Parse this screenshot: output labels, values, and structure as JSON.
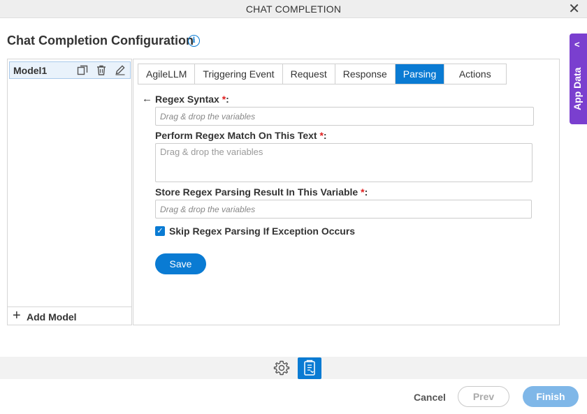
{
  "window": {
    "title": "CHAT COMPLETION",
    "close_glyph": "✕"
  },
  "heading": "Chat Completion Configuration",
  "info_glyph": "i",
  "app_data": {
    "label": "App Data",
    "chevron": "<"
  },
  "models": {
    "items": [
      {
        "label": "Model1"
      }
    ],
    "add_label": "Add Model",
    "add_glyph": "+"
  },
  "tabs": [
    {
      "label": "AgileLLM",
      "active": false
    },
    {
      "label": "Triggering Event",
      "active": false
    },
    {
      "label": "Request",
      "active": false
    },
    {
      "label": "Response",
      "active": false
    },
    {
      "label": "Parsing",
      "active": true
    },
    {
      "label": "Actions",
      "active": false
    }
  ],
  "form": {
    "back_glyph": "←",
    "regex_syntax": {
      "label": "Regex Syntax ",
      "required": "*",
      "colon": ":",
      "placeholder": "Drag & drop the variables"
    },
    "regex_text": {
      "label": "Perform Regex Match On This Text ",
      "required": "*",
      "colon": ":",
      "placeholder": "Drag & drop the variables"
    },
    "store_result": {
      "label": "Store Regex Parsing Result In This Variable ",
      "required": "*",
      "colon": ":",
      "placeholder": "Drag & drop the variables"
    },
    "skip_exception": {
      "label": "Skip Regex Parsing If Exception Occurs",
      "checked": true,
      "check_glyph": "✓"
    },
    "save_label": "Save"
  },
  "footer": {
    "cancel": "Cancel",
    "prev": "Prev",
    "finish": "Finish"
  },
  "colors": {
    "accent": "#0a7bd3",
    "app_data": "#7a3fcf",
    "required": "#e02020",
    "finish_disabled": "#7fb7e8"
  }
}
